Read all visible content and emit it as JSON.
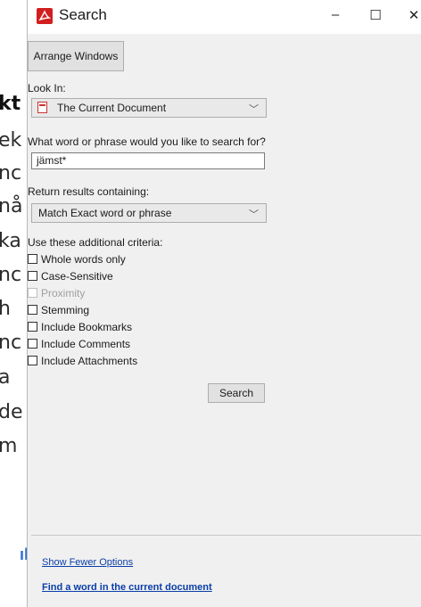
{
  "background_document": {
    "lines": [
      "kt",
      "ek",
      "nc",
      "nå",
      "ka",
      "nc",
      "h",
      "nc",
      "a",
      "de",
      "m"
    ]
  },
  "window": {
    "title": "Search",
    "app_icon": "acrobat-icon",
    "controls": {
      "minimize": "–",
      "maximize": "☐",
      "close": "✕"
    }
  },
  "toolbar": {
    "arrange_windows_label": "Arrange Windows"
  },
  "look_in": {
    "label": "Look In:",
    "selected": "The Current Document",
    "icon": "pdf-document-icon"
  },
  "search_phrase": {
    "label": "What word or phrase would you like to search for?",
    "value": "jämst*"
  },
  "return_results": {
    "label": "Return results containing:",
    "selected": "Match Exact word or phrase"
  },
  "criteria": {
    "label": "Use these additional criteria:",
    "options": [
      {
        "label": "Whole words only",
        "checked": false,
        "enabled": true
      },
      {
        "label": "Case-Sensitive",
        "checked": false,
        "enabled": true
      },
      {
        "label": "Proximity",
        "checked": false,
        "enabled": false
      },
      {
        "label": "Stemming",
        "checked": false,
        "enabled": true
      },
      {
        "label": "Include Bookmarks",
        "checked": false,
        "enabled": true
      },
      {
        "label": "Include Comments",
        "checked": false,
        "enabled": true
      },
      {
        "label": "Include Attachments",
        "checked": false,
        "enabled": true
      }
    ]
  },
  "search_button_label": "Search",
  "footer": {
    "show_fewer_label": "Show Fewer Options",
    "find_word_label": "Find a word in the current document"
  },
  "colors": {
    "window_bg": "#f0f0f0",
    "link": "#0a3ea8",
    "acrobat_red": "#d11f1f"
  }
}
